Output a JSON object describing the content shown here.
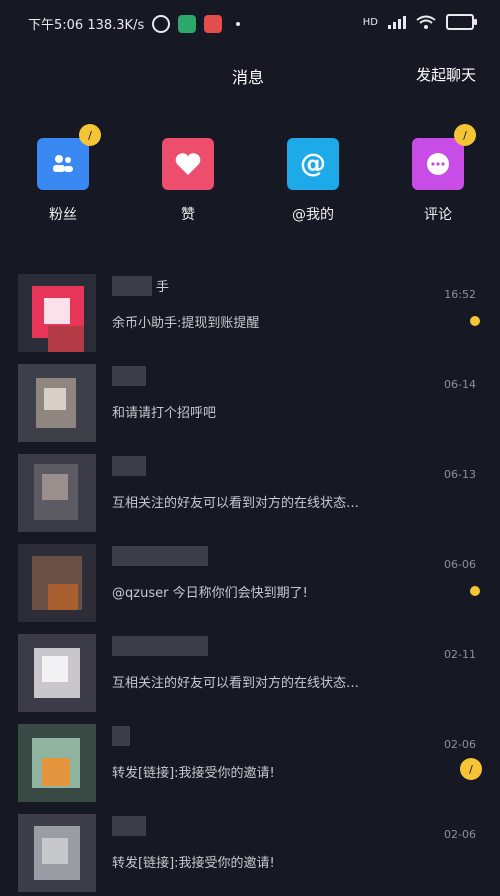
{
  "status": {
    "time_speed": "下午5:06 138.3K/s",
    "network": "HD",
    "colors": {
      "shield": "#2ca86a",
      "app": "#e44d4d"
    }
  },
  "header": {
    "title": "消息",
    "start_chat": "发起聊天"
  },
  "quick": [
    {
      "label": "粉丝",
      "icon": "fans-icon",
      "color": "#3a88f2",
      "badge": "/"
    },
    {
      "label": "赞",
      "icon": "heart-icon",
      "color": "#ee4e6d",
      "badge": ""
    },
    {
      "label": "@我的",
      "icon": "at-icon",
      "color": "#1ea9e8",
      "badge": ""
    },
    {
      "label": "评论",
      "icon": "comment-icon",
      "color": "#c84ce6",
      "badge": "/"
    }
  ],
  "conversations": [
    {
      "name": "手",
      "message": "余币小助手:提现到账提醒",
      "time": "16:52",
      "indicator": "dot"
    },
    {
      "name": "",
      "message": "和请请打个招呼吧",
      "time": "06-14",
      "indicator": ""
    },
    {
      "name": "",
      "message": "互相关注的好友可以看到对方的在线状态…",
      "time": "06-13",
      "indicator": ""
    },
    {
      "name": "",
      "message": "@qzuser 今日称你们会快到期了!",
      "time": "06-06",
      "indicator": "dot"
    },
    {
      "name": "",
      "message": "互相关注的好友可以看到对方的在线状态…",
      "time": "02-11",
      "indicator": ""
    },
    {
      "name": "",
      "message": "转发[链接]:我接受你的邀请!",
      "time": "02-06",
      "indicator": "badge",
      "badge": "/"
    },
    {
      "name": "",
      "message": "转发[链接]:我接受你的邀请!",
      "time": "02-06",
      "indicator": ""
    }
  ],
  "accent": "#f6c535"
}
